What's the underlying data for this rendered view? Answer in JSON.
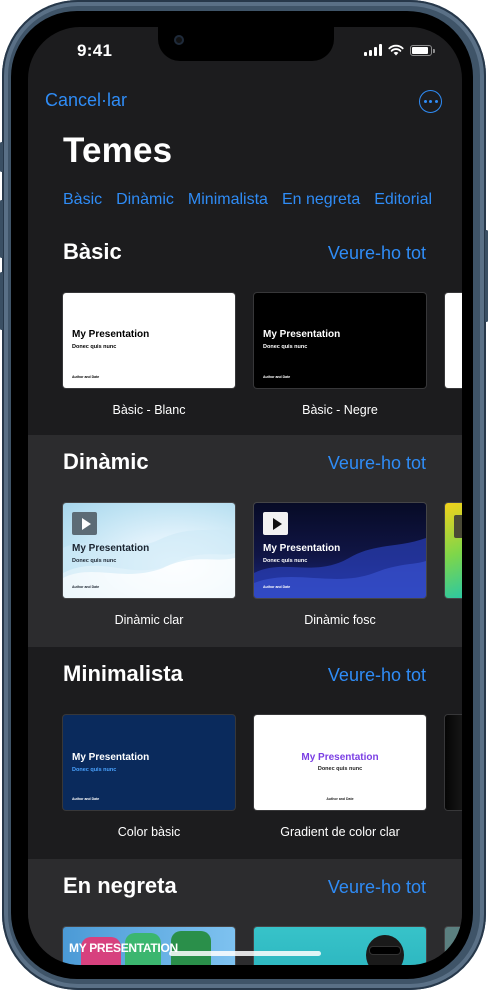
{
  "status": {
    "time": "9:41"
  },
  "nav": {
    "cancel_label": "Cancel·lar",
    "more_icon": "ellipsis-circle-icon"
  },
  "page": {
    "title": "Temes"
  },
  "tabs": [
    "Bàsic",
    "Dinàmic",
    "Minimalista",
    "En negreta",
    "Editorial"
  ],
  "see_all_label": "Veure-ho tot",
  "sections": [
    {
      "title": "Bàsic",
      "themes": [
        {
          "name": "Bàsic - Blanc",
          "slide_title": "My Presentation",
          "slide_subtitle": "Donec quis nunc",
          "slide_author": "Author and Date"
        },
        {
          "name": "Bàsic - Negre",
          "slide_title": "My Presentation",
          "slide_subtitle": "Donec quis nunc",
          "slide_author": "Author and Date"
        }
      ]
    },
    {
      "title": "Dinàmic",
      "themes": [
        {
          "name": "Dinàmic clar",
          "slide_title": "My Presentation",
          "slide_subtitle": "Donec quis nunc",
          "slide_author": "Author and Date"
        },
        {
          "name": "Dinàmic fosc",
          "slide_title": "My Presentation",
          "slide_subtitle": "Donec quis nunc",
          "slide_author": "Author and Date"
        }
      ]
    },
    {
      "title": "Minimalista",
      "themes": [
        {
          "name": "Color bàsic",
          "slide_title": "My Presentation",
          "slide_subtitle": "Donec quis nunc",
          "slide_author": "Author and Date"
        },
        {
          "name": "Gradient de color clar",
          "slide_title": "My Presentation",
          "slide_subtitle": "Donec quis nunc",
          "slide_author": "Author and Date"
        }
      ]
    },
    {
      "title": "En negreta",
      "themes": [
        {
          "slide_title": "MY PRESENTATION"
        }
      ]
    }
  ],
  "colors": {
    "accent": "#2F8CF6",
    "background": "#1C1C1E",
    "section_alt": "#2C2C2E",
    "device_frame": "#3F5468"
  }
}
